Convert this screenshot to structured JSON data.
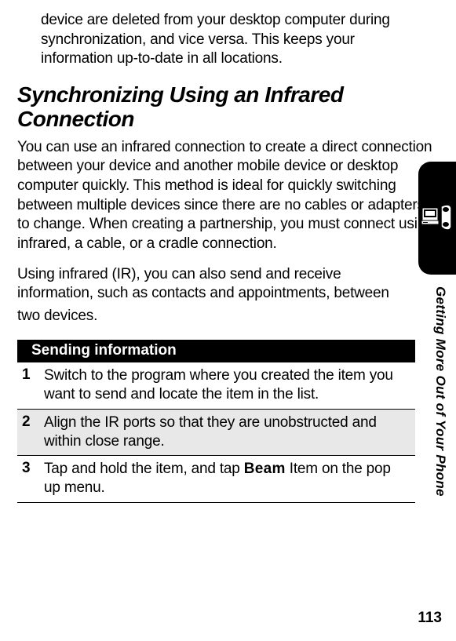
{
  "intro_paragraph": "device are deleted from your desktop computer during synchronization, and vice versa. This keeps your information up-to-date in all locations.",
  "heading": "Synchronizing Using an Infrared Connection",
  "paragraph1": "You can use an infrared connection to create a direct connection between your device and another mobile device or desktop computer quickly. This method is ideal for quickly switching between multiple devices since there are no cables or adapters to change. When creating a partnership, you must connect using infrared, a cable, or a cradle connection.",
  "paragraph2_part1": "Using infrared (IR), you can also send and receive information, such as contacts and appointments, between ",
  "paragraph2_part2": "two devices.",
  "instructions": {
    "header": "Sending information",
    "steps": [
      {
        "num": "1",
        "text": "Switch to the program where you created the item you want to send and locate the item in the list."
      },
      {
        "num": "2",
        "text": "Align the IR ports so that they are unobstructed and within close range."
      },
      {
        "num": "3",
        "before": "Tap and hold the item, and tap ",
        "bold": "Beam",
        "after": " Item on the pop up menu."
      }
    ]
  },
  "side_label": "Getting More Out of Your Phone",
  "page_number": "113"
}
